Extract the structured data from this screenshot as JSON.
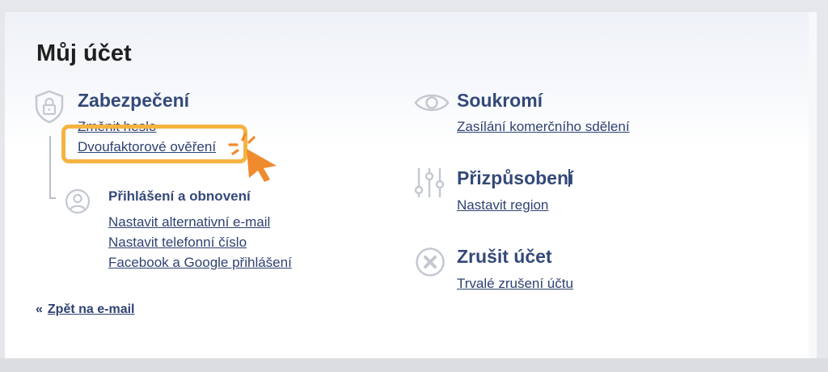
{
  "page": {
    "title": "Můj účet",
    "back_quote": "«",
    "back_label": "Zpět na e-mail"
  },
  "security": {
    "title": "Zabezpečení",
    "links": [
      "Změnit heslo",
      "Dvoufaktorové ověření"
    ],
    "login": {
      "title": "Přihlášení a obnovení",
      "links": [
        "Nastavit alternativní e-mail",
        "Nastavit telefonní číslo",
        "Facebook a Google přihlášení"
      ]
    }
  },
  "privacy": {
    "title": "Soukromí",
    "link": "Zasílání komerčního sdělení"
  },
  "customization": {
    "title": "Přizpůsobení",
    "link": "Nastavit region"
  },
  "cancel": {
    "title": "Zrušit účet",
    "link": "Trvalé zrušení účtu"
  },
  "colors": {
    "accent": "#34497a",
    "link": "#2f4272",
    "highlight": "#f5b342",
    "cursor": "#f08a2e",
    "icon": "#c3c8d1"
  },
  "icons": [
    "shield-lock-icon",
    "user-icon",
    "eye-icon",
    "sliders-icon",
    "x-circle-icon",
    "pointer-cursor-icon"
  ]
}
